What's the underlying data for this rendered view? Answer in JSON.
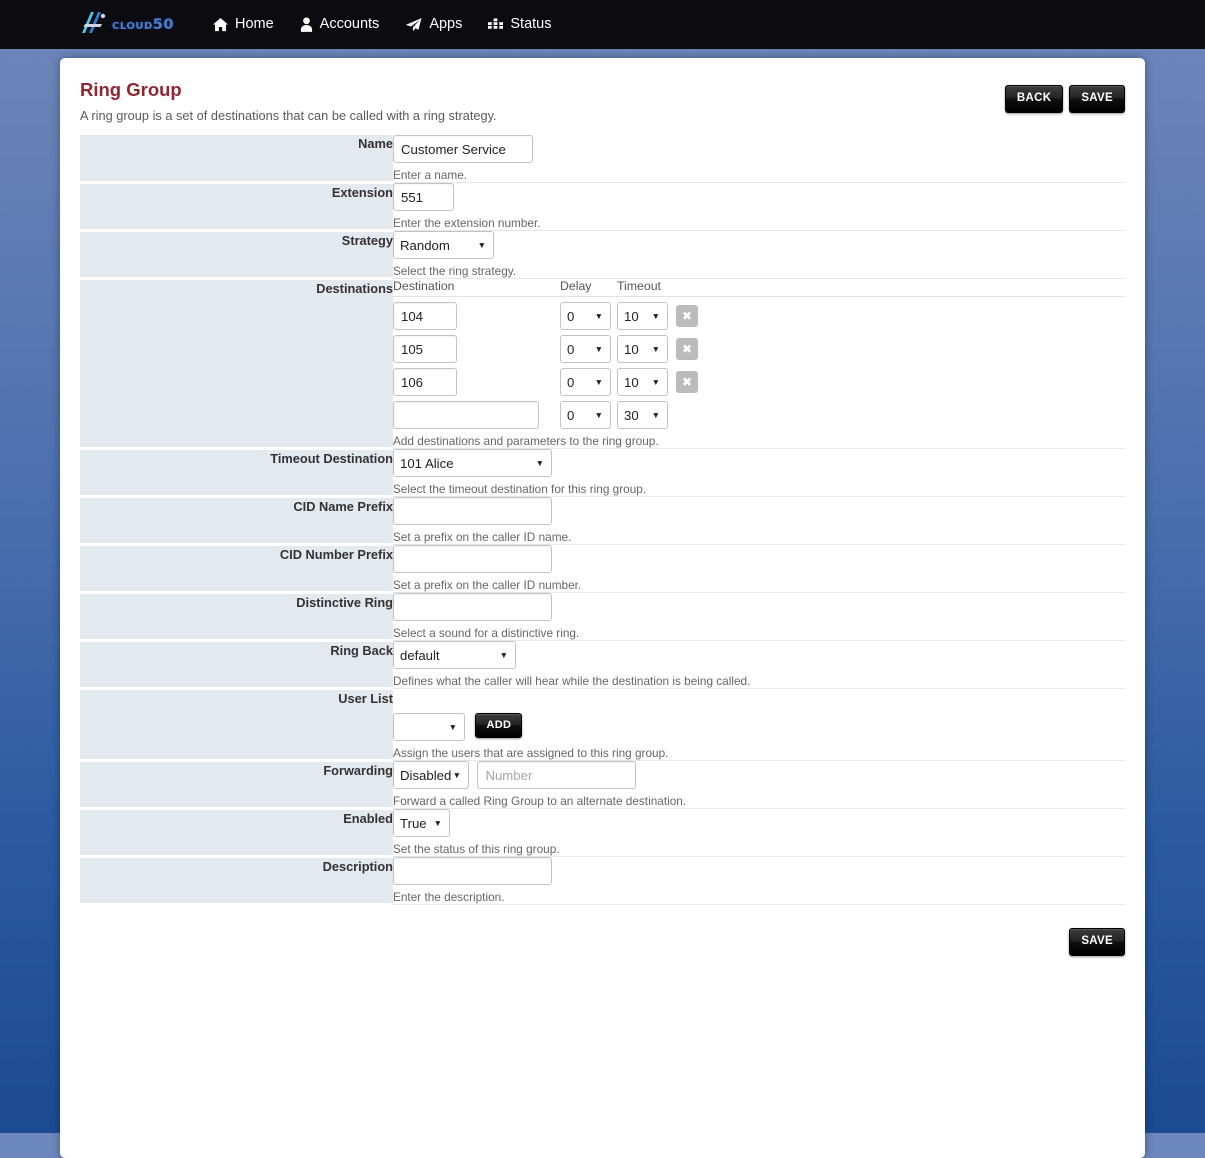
{
  "navbar": {
    "brand": "Cloud50",
    "brand_icon": "a-logo-mark",
    "links": [
      {
        "label": "Home",
        "icon": "home-icon"
      },
      {
        "label": "Accounts",
        "icon": "user-icon"
      },
      {
        "label": "Apps",
        "icon": "paper-plane-icon"
      },
      {
        "label": "Status",
        "icon": "bar-chart-icon"
      }
    ]
  },
  "page": {
    "title": "Ring Group",
    "subtitle": "A ring group is a set of destinations that can be called with a ring strategy.",
    "back_label": "BACK",
    "save_label": "SAVE",
    "footer_save_label": "SAVE",
    "title_color": "#8f2733"
  },
  "fields": {
    "name": {
      "label": "Name",
      "value": "Customer Service",
      "description": "Enter a name."
    },
    "extension": {
      "label": "Extension",
      "value": "551",
      "description": "Enter the extension number."
    },
    "strategy": {
      "label": "Strategy",
      "value": "Random",
      "description": "Select the ring strategy."
    },
    "destinations": {
      "label": "Destinations",
      "columns": {
        "destination": "Destination",
        "delay": "Delay",
        "timeout": "Timeout"
      },
      "rows": [
        {
          "destination": "104",
          "delay": "0",
          "timeout": "10",
          "remove_icon": "close-icon",
          "removable": true
        },
        {
          "destination": "105",
          "delay": "0",
          "timeout": "10",
          "remove_icon": "close-icon",
          "removable": true
        },
        {
          "destination": "106",
          "delay": "0",
          "timeout": "10",
          "remove_icon": "close-icon",
          "removable": true
        },
        {
          "destination": "",
          "delay": "0",
          "timeout": "30",
          "remove_icon": "",
          "removable": false
        }
      ],
      "description": "Add destinations and parameters to the ring group."
    },
    "timeout_destination": {
      "label": "Timeout Destination",
      "value": "101 Alice",
      "description": "Select the timeout destination for this ring group."
    },
    "cid_name_prefix": {
      "label": "CID Name Prefix",
      "value": "",
      "description": "Set a prefix on the caller ID name."
    },
    "cid_number_prefix": {
      "label": "CID Number Prefix",
      "value": "",
      "description": "Set a prefix on the caller ID number."
    },
    "distinctive_ring": {
      "label": "Distinctive Ring",
      "value": "",
      "description": "Select a sound for a distinctive ring."
    },
    "ring_back": {
      "label": "Ring Back",
      "value": "default",
      "description": "Defines what the caller will hear while the destination is being called."
    },
    "user_list": {
      "label": "User List",
      "value": "",
      "add_label": "ADD",
      "description": "Assign the users that are assigned to this ring group."
    },
    "forwarding": {
      "label": "Forwarding",
      "value": "Disabled",
      "number_value": "",
      "number_placeholder": "Number",
      "description": "Forward a called Ring Group to an alternate destination."
    },
    "enabled": {
      "label": "Enabled",
      "value": "True",
      "description": "Set the status of this ring group."
    },
    "description_field": {
      "label": "Description",
      "value": "",
      "description": "Enter the description."
    }
  }
}
